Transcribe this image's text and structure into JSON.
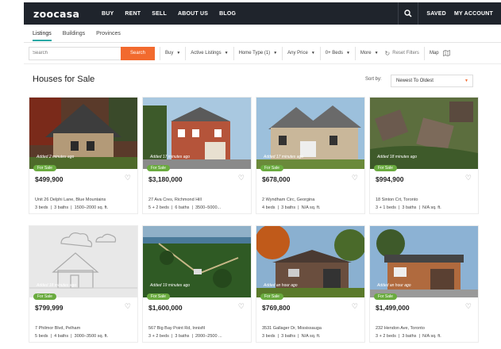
{
  "nav": {
    "logo": "zoocasa",
    "links": [
      "BUY",
      "RENT",
      "SELL",
      "ABOUT US",
      "BLOG"
    ],
    "saved": "SAVED",
    "account": "MY ACCOUNT"
  },
  "subtabs": [
    "Listings",
    "Buildings",
    "Provinces"
  ],
  "filters": {
    "search_placeholder": "Search",
    "search_button": "Search",
    "buy": "Buy",
    "listings": "Active Listings",
    "home_type": "Home Type (1)",
    "price": "Any Price",
    "beds": "0+ Beds",
    "more": "More",
    "reset": "Reset Filters",
    "map": "Map"
  },
  "page_title": "Houses for Sale",
  "sort": {
    "label": "Sort by:",
    "value": "Newest To Oldest"
  },
  "colors": {
    "accent": "#f26a2e",
    "badge": "#6aab3f",
    "nav_bg": "#1f242c",
    "tab_underline": "#29a9a5"
  },
  "listings": [
    {
      "price": "$499,900",
      "added": "Added 2 minutes ago",
      "status": "For Sale",
      "address": "Unit 26 Delphi Lane, Blue Mountains",
      "beds": "3 beds",
      "baths": "3 baths",
      "sqft": "1500–2000 sq. ft."
    },
    {
      "price": "$3,180,000",
      "added": "Added 17 minutes ago",
      "status": "For Sale",
      "address": "27 Ava Cres, Richmond Hill",
      "beds": "5 + 2 beds",
      "baths": "6 baths",
      "sqft": "3500–5000..."
    },
    {
      "price": "$678,000",
      "added": "Added 17 minutes ago",
      "status": "For Sale",
      "address": "2 Wyndham Circ, Georgina",
      "beds": "4 beds",
      "baths": "3 baths",
      "sqft": "N/A sq. ft."
    },
    {
      "price": "$994,900",
      "added": "Added 18 minutes ago",
      "status": "For Sale",
      "address": "18 Sinton Crt, Toronto",
      "beds": "3 + 1 beds",
      "baths": "3 baths",
      "sqft": "N/A sq. ft."
    },
    {
      "price": "$799,999",
      "added": "Added 18 minutes ago",
      "status": "For Sale",
      "address": "7 Philmor Blvd, Pelham",
      "beds": "5 beds",
      "baths": "4 baths",
      "sqft": "3000–3500 sq. ft."
    },
    {
      "price": "$1,600,000",
      "added": "Added 19 minutes ago",
      "status": "For Sale",
      "address": "567 Big Bay Point Rd, Innisfil",
      "beds": "3 + 2 beds",
      "baths": "3 baths",
      "sqft": "2000–2500 ..."
    },
    {
      "price": "$769,800",
      "added": "Added an hour ago",
      "status": "For Sale",
      "address": "3531 Gallager Dr, Mississauga",
      "beds": "3 beds",
      "baths": "3 baths",
      "sqft": "N/A sq. ft."
    },
    {
      "price": "$1,499,000",
      "added": "Added an hour ago",
      "status": "For Sale",
      "address": "232 Hendon Ave, Toronto",
      "beds": "3 + 2 beds",
      "baths": "3 baths",
      "sqft": "N/A sq. ft."
    }
  ]
}
